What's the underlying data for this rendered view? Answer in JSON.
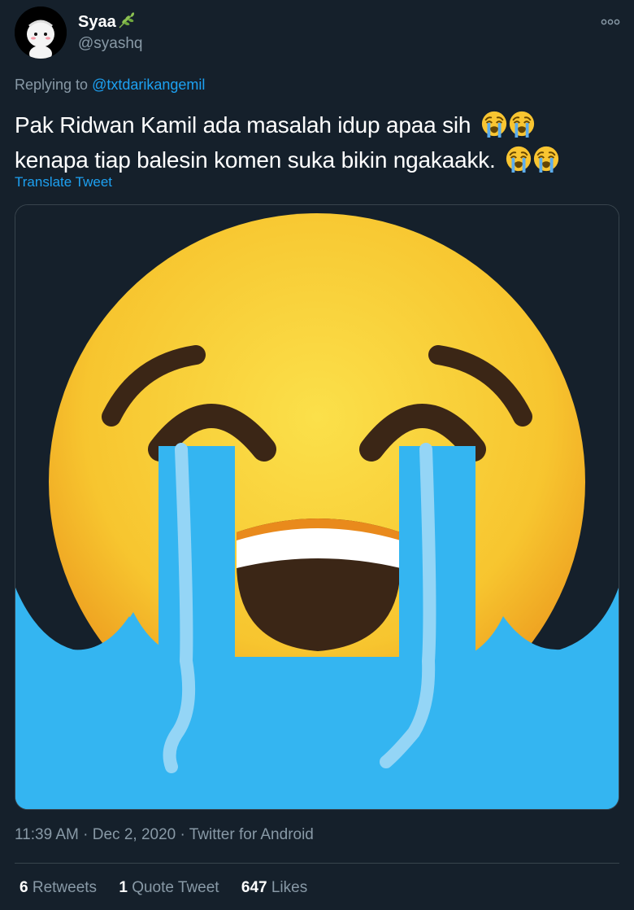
{
  "user": {
    "display_name": "Syaa",
    "handle": "@syashq"
  },
  "reply": {
    "prefix": "Replying to ",
    "mention": "@txtdarikangemil"
  },
  "tweet": {
    "line1": "Pak Ridwan Kamil ada masalah idup apaa sih",
    "line2": "kenapa tiap balesin komen suka bikin ngakaakk.",
    "translate_label": "Translate Tweet"
  },
  "meta": {
    "timestamp": "11:39 AM · Dec 2, 2020 · Twitter for Android"
  },
  "stats": {
    "retweets_count": "6",
    "retweets_label": "Retweets",
    "quotes_count": "1",
    "quotes_label": "Quote Tweet",
    "likes_count": "647",
    "likes_label": "Likes"
  },
  "icons": {
    "media": "loudly-crying-face-emoji",
    "inline": "loudly-crying-face-emoji",
    "leaf": "herb-icon",
    "more": "more-options-icon"
  },
  "colors": {
    "background": "#15202b",
    "secondary_text": "#8899a6",
    "link": "#1da1f2",
    "divider": "#38444d"
  }
}
